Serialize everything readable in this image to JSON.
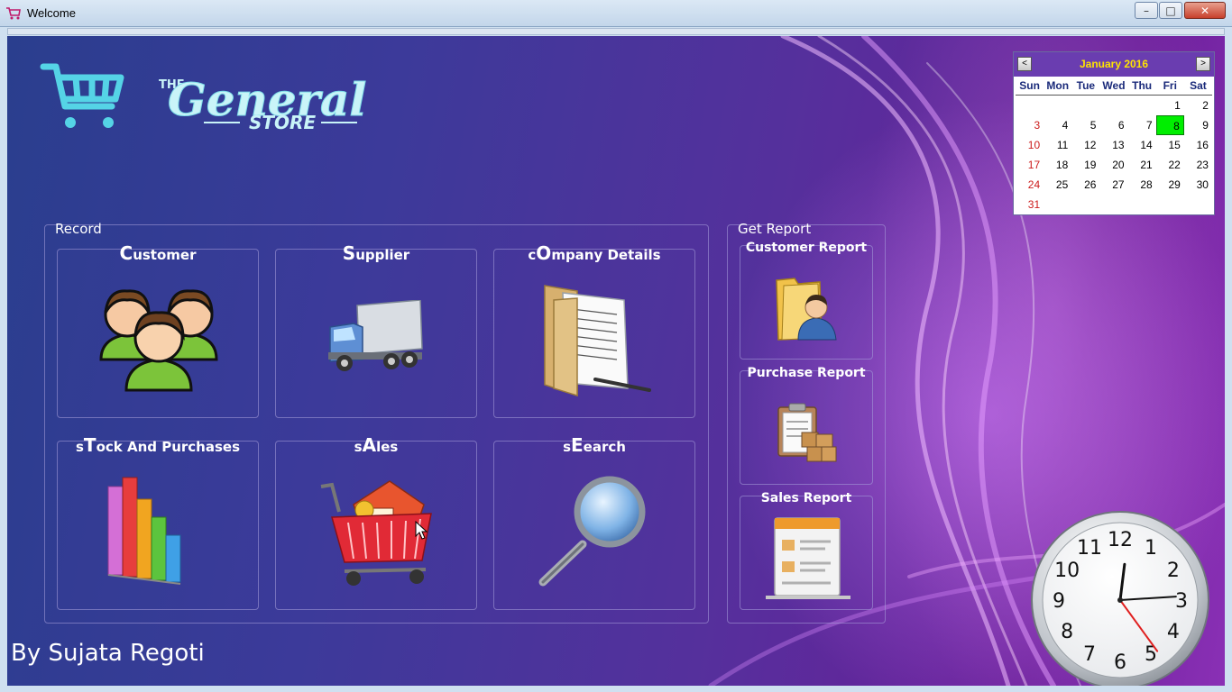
{
  "window": {
    "title": "Welcome",
    "minimize": "–",
    "maximize": "□",
    "close": "✕"
  },
  "colors": {
    "accent_cart": "#55d4e6",
    "calendar_header": "#6a3db0",
    "calendar_title": "#ffe400",
    "calendar_today": "#00ee00",
    "sunday": "#cc1b1b"
  },
  "logo": {
    "the": "THE",
    "general": "General",
    "store": "STORE"
  },
  "record": {
    "label": "Record",
    "tiles": [
      {
        "first": "C",
        "rest": "ustomer",
        "pre": "",
        "icon": "people-icon"
      },
      {
        "first": "S",
        "rest": "upplier",
        "pre": "",
        "icon": "truck-icon"
      },
      {
        "pre": "c",
        "first": "O",
        "rest": "mpany Details",
        "icon": "documents-icon"
      },
      {
        "pre": "s",
        "first": "T",
        "rest": "ock And Purchases",
        "icon": "bar-chart-icon"
      },
      {
        "pre": "s",
        "first": "A",
        "rest": "les",
        "icon": "shopping-cart-icon"
      },
      {
        "pre": "s",
        "first": "E",
        "rest": "earch",
        "icon": "magnifier-icon"
      }
    ]
  },
  "report": {
    "label": "Get Report",
    "tiles": [
      {
        "label": "Customer Report",
        "icon": "user-folder-icon"
      },
      {
        "label": "Purchase Report",
        "icon": "clipboard-boxes-icon"
      },
      {
        "label": "Sales Report",
        "icon": "sales-document-icon"
      }
    ]
  },
  "calendar": {
    "title": "January 2016",
    "prev": "<",
    "next": ">",
    "days_of_week": [
      "Sun",
      "Mon",
      "Tue",
      "Wed",
      "Thu",
      "Fri",
      "Sat"
    ],
    "weeks": [
      [
        "",
        "",
        "",
        "",
        "",
        "1",
        "2"
      ],
      [
        "3",
        "4",
        "5",
        "6",
        "7",
        "8",
        "9"
      ],
      [
        "10",
        "11",
        "12",
        "13",
        "14",
        "15",
        "16"
      ],
      [
        "17",
        "18",
        "19",
        "20",
        "21",
        "22",
        "23"
      ],
      [
        "24",
        "25",
        "26",
        "27",
        "28",
        "29",
        "30"
      ],
      [
        "31",
        "",
        "",
        "",
        "",
        "",
        ""
      ]
    ],
    "selected_day": "8"
  },
  "clock": {
    "numbers": [
      "12",
      "1",
      "2",
      "3",
      "4",
      "5",
      "6",
      "7",
      "8",
      "9",
      "10",
      "11"
    ],
    "hour": 12,
    "minute": 14,
    "second": 24
  },
  "footer": {
    "author": "By Sujata Regoti"
  }
}
